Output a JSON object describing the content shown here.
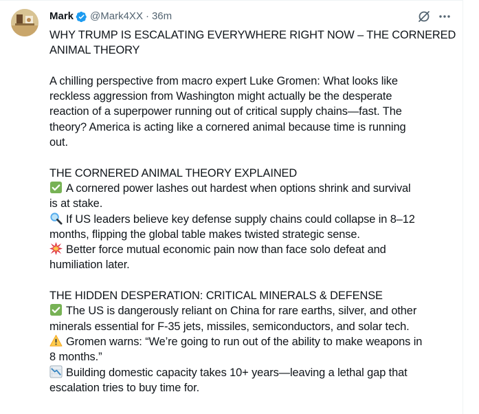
{
  "author": {
    "name": "Mark",
    "handle": "@Mark4XX",
    "separator": "·",
    "time": "36m"
  },
  "icons": {
    "verified": "verified-badge-icon",
    "grok": "grok-icon",
    "more": "more-icon",
    "check": "check-mark-emoji-icon",
    "search": "magnifier-emoji-icon",
    "collision": "collision-emoji-icon",
    "warning": "warning-emoji-icon",
    "chart": "chart-decreasing-emoji-icon"
  },
  "colors": {
    "text": "#0f1419",
    "secondary": "#536471",
    "verified": "#1d9bf0",
    "check_green": "#77b255",
    "warning_yellow": "#ffcc4d"
  },
  "tweet": {
    "title_1": "WHY TRUMP IS ESCALATING EVERYWHERE RIGHT NOW – THE CORNERED",
    "title_2": "ANIMAL THEORY",
    "intro_1": "A chilling perspective from macro expert Luke Gromen: What looks like",
    "intro_2": "reckless aggression from Washington might actually be the desperate",
    "intro_3": "reaction of a superpower running out of critical supply chains—fast. The",
    "intro_4": "theory? America is acting like a cornered animal because time is running",
    "intro_5": "out.",
    "section1_heading": "THE CORNERED ANIMAL THEORY EXPLAINED",
    "s1_b1_1": "A cornered power lashes out hardest when options shrink and survival",
    "s1_b1_2": "is at stake.",
    "s1_b2_1": "If US leaders believe key defense supply chains could collapse in 8–12",
    "s1_b2_2": "months, flipping the global table makes twisted strategic sense.",
    "s1_b3_1": "Better force mutual economic pain now than face solo defeat and",
    "s1_b3_2": "humiliation later.",
    "section2_heading": "THE HIDDEN DESPERATION: CRITICAL MINERALS & DEFENSE",
    "s2_b1_1": "The US is dangerously reliant on China for rare earths, silver, and other",
    "s2_b1_2": "minerals essential for F-35 jets, missiles, semiconductors, and solar tech.",
    "s2_b2_1": "Gromen warns: “We’re going to run out of the ability to make weapons in",
    "s2_b2_2": "8 months.”",
    "s2_b3_1": "Building domestic capacity takes 10+ years—leaving a lethal gap that",
    "s2_b3_2": "escalation tries to buy time for."
  }
}
